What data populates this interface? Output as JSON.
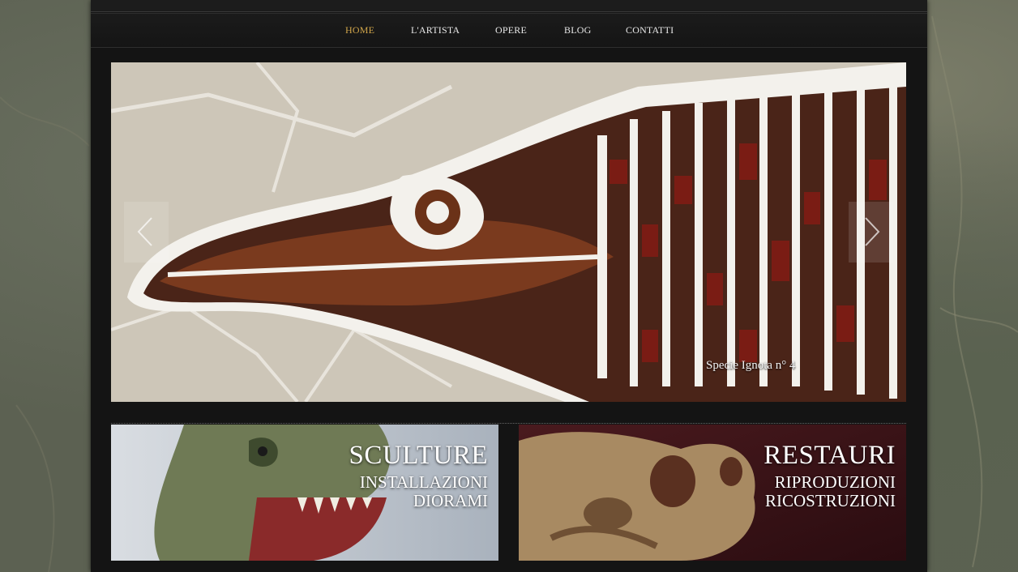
{
  "nav": {
    "items": [
      {
        "label": "HOME",
        "active": true
      },
      {
        "label": "L'ARTISTA"
      },
      {
        "label": "OPERE"
      },
      {
        "label": "BLOG"
      },
      {
        "label": "CONTATTI"
      }
    ]
  },
  "slider": {
    "caption": "Specie Ignota n° 4",
    "prev_icon": "chevron-left-icon",
    "next_icon": "chevron-right-icon"
  },
  "banners": {
    "left": {
      "title": "SCULTURE",
      "line1": "INSTALLAZIONI",
      "line2": "DIORAMI"
    },
    "right": {
      "title": "RESTAURI",
      "line1": "RIPRODUZIONI",
      "line2": "RICOSTRUZIONI"
    }
  },
  "colors": {
    "accent": "#d0a54a",
    "page_bg": "#141414",
    "nav_text": "#e8e8e8"
  }
}
